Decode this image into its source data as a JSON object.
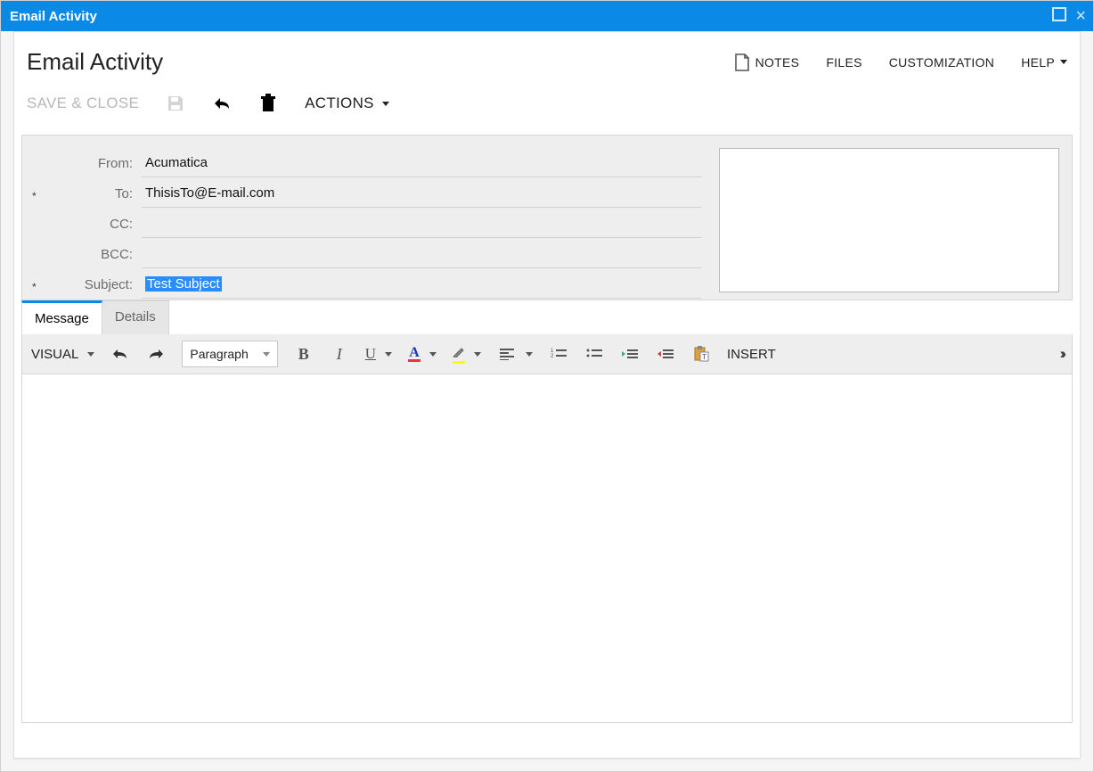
{
  "window": {
    "title": "Email Activity"
  },
  "header": {
    "title": "Email Activity"
  },
  "rightlinks": {
    "notes": "NOTES",
    "files": "FILES",
    "customization": "CUSTOMIZATION",
    "help": "HELP"
  },
  "toolbar": {
    "save_close": "SAVE & CLOSE",
    "actions": "ACTIONS"
  },
  "form": {
    "from_label": "From:",
    "from_value": "Acumatica",
    "to_label": "To:",
    "to_value": "ThisisTo@E-mail.com",
    "cc_label": "CC:",
    "cc_value": "",
    "bcc_label": "BCC:",
    "bcc_value": "",
    "subject_label": "Subject:",
    "subject_value": "Test Subject"
  },
  "tabs": {
    "message": "Message",
    "details": "Details"
  },
  "editor": {
    "visual": "VISUAL",
    "paragraph": "Paragraph",
    "insert": "INSERT",
    "bold": "B",
    "italic": "I",
    "underline": "U",
    "fontcolor": "A"
  }
}
